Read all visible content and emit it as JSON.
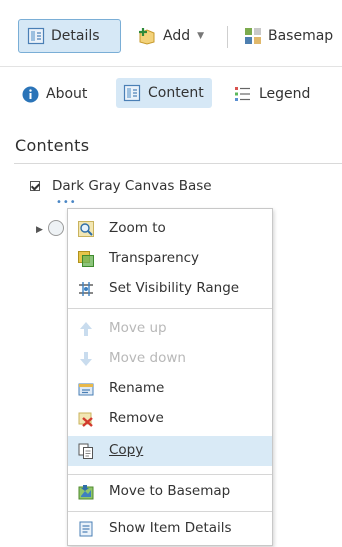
{
  "toolbar": {
    "details_label": "Details",
    "add_label": "Add",
    "basemap_label": "Basemap"
  },
  "tabs": {
    "about": "About",
    "content": "Content",
    "legend": "Legend"
  },
  "contents": {
    "title": "Contents",
    "layers": [
      {
        "label": "Dark Gray Canvas Base",
        "checked": true
      }
    ]
  },
  "context_menu": {
    "items": [
      {
        "label": "Zoom to",
        "icon": "zoom-icon",
        "enabled": true
      },
      {
        "label": "Transparency",
        "icon": "transparency-icon",
        "enabled": true
      },
      {
        "label": "Set Visibility Range",
        "icon": "visibility-range-icon",
        "enabled": true
      },
      {
        "label": "Move up",
        "icon": "arrow-up-icon",
        "enabled": false
      },
      {
        "label": "Move down",
        "icon": "arrow-down-icon",
        "enabled": false
      },
      {
        "label": "Rename",
        "icon": "rename-icon",
        "enabled": true
      },
      {
        "label": "Remove",
        "icon": "remove-icon",
        "enabled": true
      },
      {
        "label": "Copy",
        "icon": "copy-icon",
        "enabled": true,
        "highlighted": true
      },
      {
        "label": "Move to Basemap",
        "icon": "move-to-basemap-icon",
        "enabled": true
      },
      {
        "label": "Show Item Details",
        "icon": "item-details-icon",
        "enabled": true
      }
    ]
  },
  "colors": {
    "accent_bg": "#d6e8f6",
    "accent_border": "#7aaed6",
    "highlight_bg": "#d9eaf6",
    "disabled_text": "#b8b8b8"
  }
}
